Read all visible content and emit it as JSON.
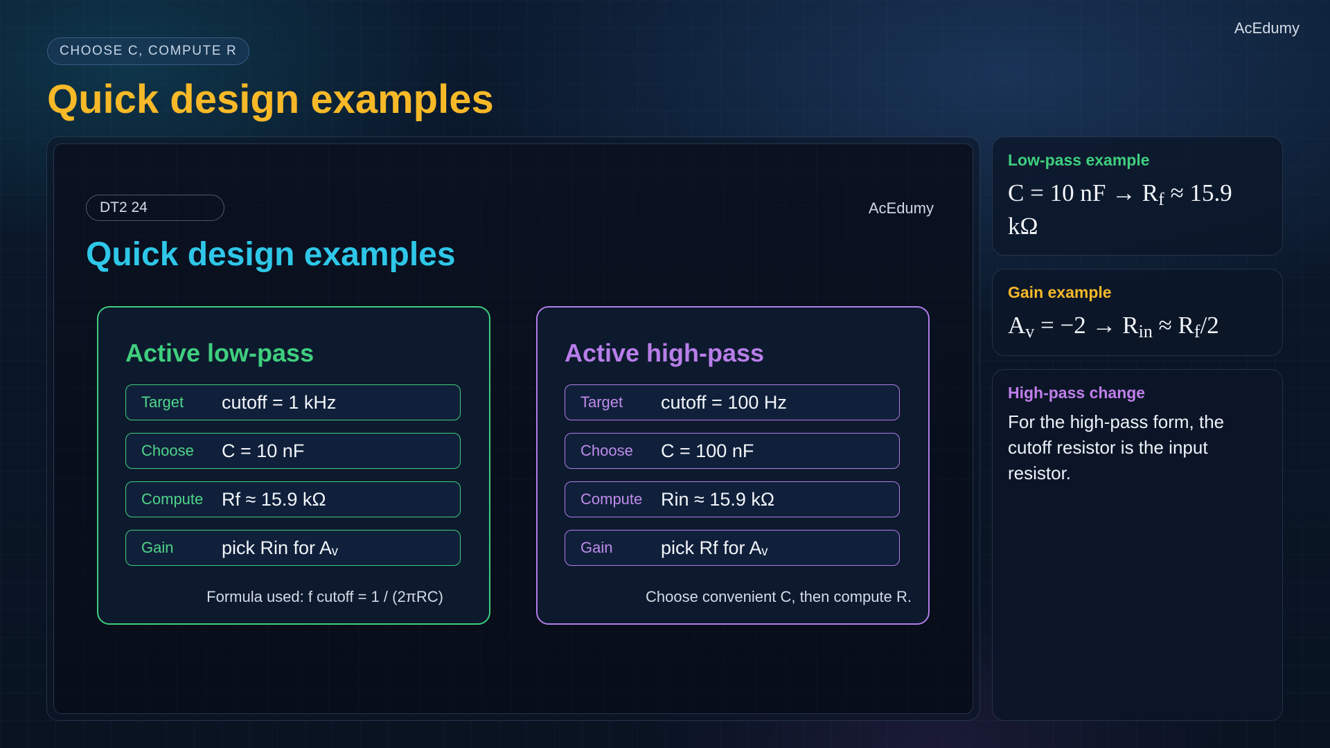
{
  "header": {
    "brand": "AcEdumy",
    "eyebrow": "CHOOSE C, COMPUTE R",
    "title": "Quick design examples"
  },
  "slide": {
    "tag": "DT2 24",
    "brand": "AcEdumy",
    "title": "Quick design examples",
    "cards": [
      {
        "title": "Active low-pass",
        "accent": "#3fcf7e",
        "rows": [
          {
            "label": "Target",
            "value": "cutoff = 1 kHz"
          },
          {
            "label": "Choose",
            "value": "C = 10 nF"
          },
          {
            "label": "Compute",
            "value": "Rf ≈ 15.9 kΩ"
          },
          {
            "label": "Gain",
            "value": "pick Rin for Aᵥ"
          }
        ],
        "note": "Formula used: f cutoff = 1 / (2πRC)"
      },
      {
        "title": "Active high-pass",
        "accent": "#b27ce9",
        "rows": [
          {
            "label": "Target",
            "value": "cutoff = 100 Hz"
          },
          {
            "label": "Choose",
            "value": "C = 100 nF"
          },
          {
            "label": "Compute",
            "value": "Rin ≈ 15.9 kΩ"
          },
          {
            "label": "Gain",
            "value": "pick Rf for Aᵥ"
          }
        ],
        "note": "Choose convenient C, then compute R."
      }
    ]
  },
  "side": {
    "lowpass": {
      "heading": "Low-pass example",
      "eq_a": "C = 10 nF → R",
      "eq_a_sub": "f",
      "eq_b": " ≈ 15.9 kΩ"
    },
    "gain": {
      "heading": "Gain example",
      "eq_a": "A",
      "eq_a_sub": "v",
      "eq_b": " = −2 → R",
      "eq_b_sub": "in",
      "eq_c": " ≈ R",
      "eq_c_sub": "f",
      "eq_d": "/2"
    },
    "highpass": {
      "heading": "High-pass change",
      "text": "For the high-pass form, the cutoff resistor is the input resistor."
    }
  },
  "colors": {
    "title_gold": "#f7b928",
    "slide_title_cyan": "#2ec7e8",
    "green": "#3fcf7e",
    "purple": "#b27ce9"
  }
}
